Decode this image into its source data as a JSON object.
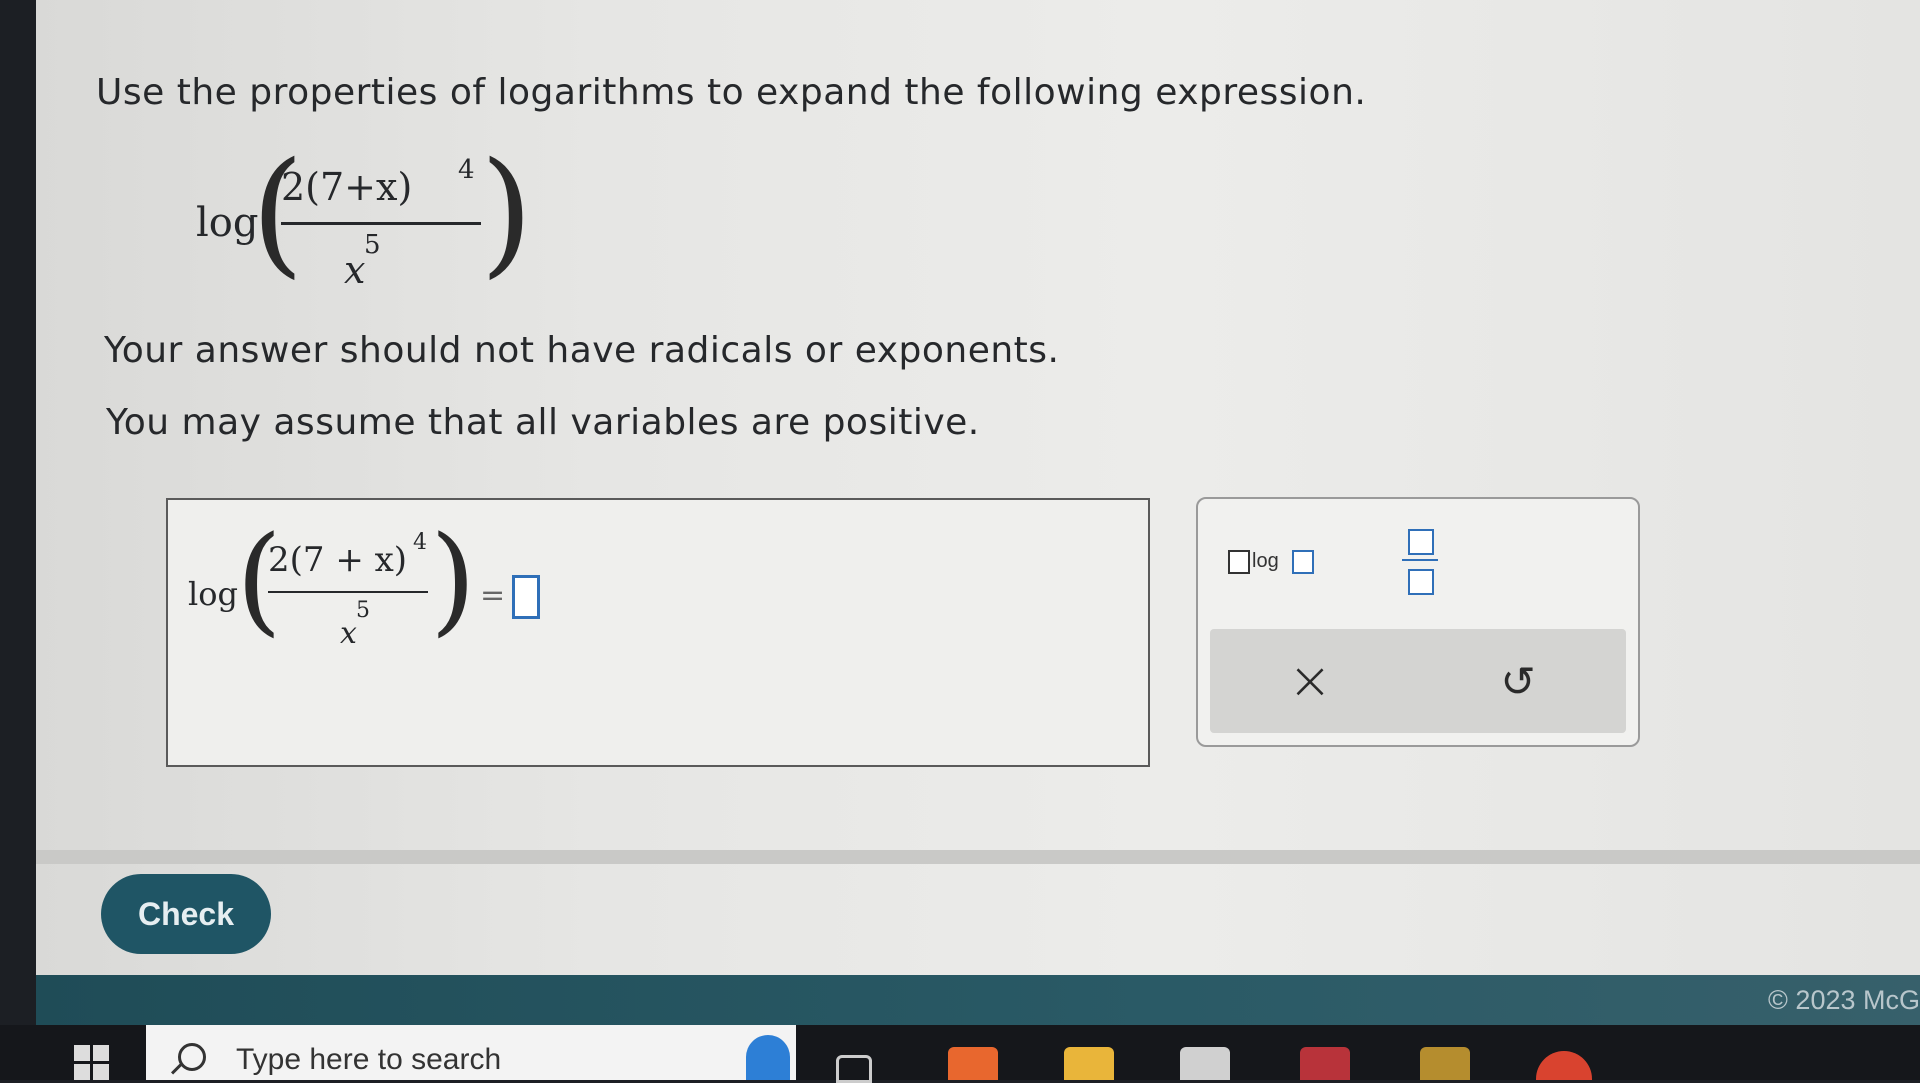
{
  "question": {
    "instruction": "Use the properties of logarithms to expand the following expression.",
    "note1": "Your answer should not have radicals or exponents.",
    "note2": "You may assume that all variables are positive."
  },
  "expression": {
    "fn": "log",
    "numerator": "2(7+x)",
    "numerator_exponent": "4",
    "denominator": "x",
    "denominator_exponent": "5"
  },
  "answer": {
    "fn": "log",
    "numerator": "2(7 + x)",
    "numerator_exponent": "4",
    "denominator": "x",
    "denominator_exponent": "5",
    "equals": "="
  },
  "palette": {
    "log_label": "log",
    "buttons": [
      "log-template",
      "fraction-template",
      "clear",
      "undo"
    ],
    "clear_symbol": "×",
    "undo_symbol": "↺"
  },
  "check_label": "Check",
  "footer": {
    "copyright": "© 2023 McG"
  },
  "taskbar": {
    "search_placeholder": "Type here to search",
    "icons": [
      "windows-icon",
      "search-icon",
      "copilot-icon",
      "task-view-icon",
      "firefox-icon",
      "file-explorer-icon",
      "store-icon",
      "access-icon",
      "excel-icon",
      "chrome-icon"
    ]
  }
}
